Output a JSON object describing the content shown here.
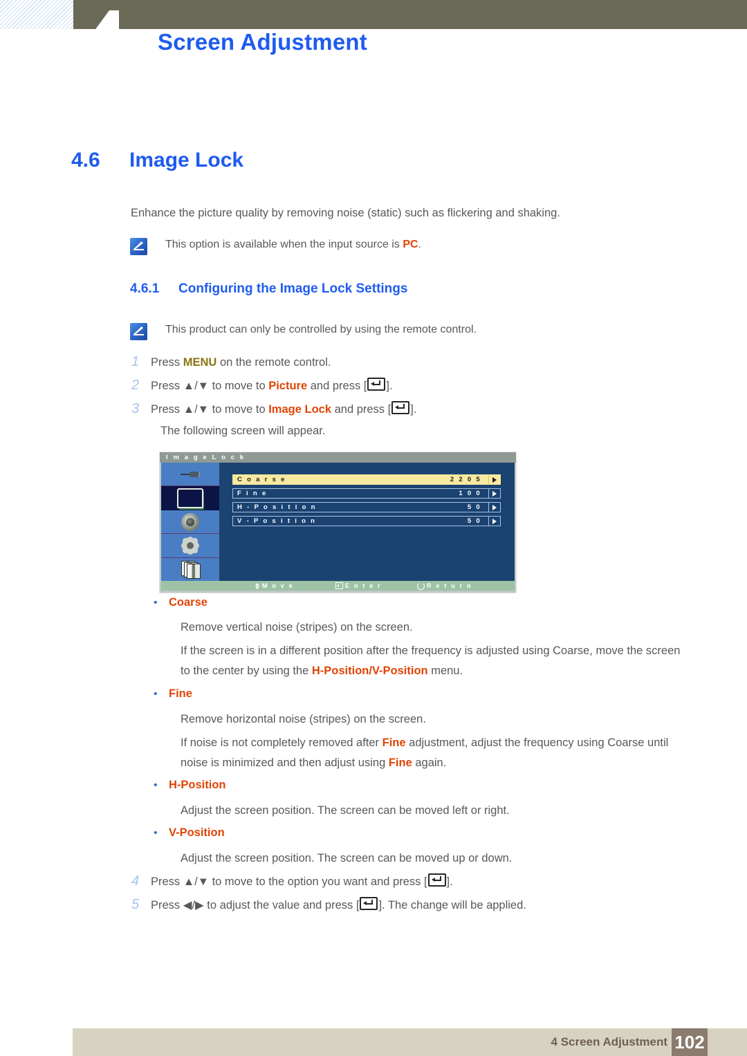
{
  "header": {
    "chapter_number": "4",
    "title": "Screen Adjustment"
  },
  "section": {
    "number": "4.6",
    "title": "Image Lock"
  },
  "intro": "Enhance the picture quality by removing noise (static) such as flickering and shaking.",
  "notes": [
    {
      "icon": "note-pencil-icon",
      "text_before": "This option is available when the input source is ",
      "keyword": "PC",
      "text_after": "."
    },
    {
      "icon": "note-pencil-icon",
      "text": "This product can only be controlled by using the remote control."
    }
  ],
  "subsection": {
    "number": "4.6.1",
    "title": "Configuring the Image Lock Settings"
  },
  "steps": [
    {
      "number": "1",
      "pre": "Press ",
      "keyword": "MENU",
      "keyword_color": "olive",
      "post": " on the remote control."
    },
    {
      "number": "2",
      "pre": "Press ▲/▼ to move to ",
      "keyword": "Picture",
      "keyword_color": "orange",
      "post": " and press [",
      "tail": "]."
    },
    {
      "number": "3",
      "pre": "Press ▲/▼ to move to ",
      "keyword": "Image Lock",
      "keyword_color": "orange",
      "post": " and press [",
      "tail": "]."
    },
    {
      "number": "4",
      "pre": "Press ▲/▼ to move to the option you want and press [",
      "tail": "]."
    },
    {
      "number": "5",
      "pre": "Press ◀/▶ to adjust the value and press [",
      "tail": "]. The change will be applied."
    }
  ],
  "step3_follow_up": "The following screen will appear.",
  "osd": {
    "title": "I m a g e   L o c k",
    "sidebar_icons": [
      "input-plug-icon",
      "monitor-picture-icon",
      "speaker-sound-icon",
      "gear-setup-icon",
      "multiscreen-stack-icon"
    ],
    "active_sidebar_index": 1,
    "rows": [
      {
        "label": "C o a r s e",
        "value": "2 2 0 5",
        "highlighted": true
      },
      {
        "label": "F i n e",
        "value": "1 0 0",
        "highlighted": false
      },
      {
        "label": "H - P o s i t i o n",
        "value": "5 0",
        "highlighted": false
      },
      {
        "label": "V - P o s i t i o n",
        "value": "5 0",
        "highlighted": false
      }
    ],
    "footer": {
      "move": "M o v e",
      "enter": "E n t e r",
      "return": "R e t u r n"
    },
    "colors": {
      "panel_bg": "#1b4372",
      "sidebar_bg": "#4a7ec4",
      "highlight": "#f7e9a0",
      "title_bar": "#8e9a93",
      "footer_bar": "#9ec2a6"
    }
  },
  "bullets": [
    {
      "title": "Coarse",
      "paragraphs": [
        "Remove vertical noise (stripes) on the screen.",
        {
          "pre": "If the screen is in a different position after the frequency is adjusted using Coarse, move the screen to the center by using the ",
          "keyword": "H-Position/V-Position",
          "post": " menu."
        }
      ]
    },
    {
      "title": "Fine",
      "paragraphs": [
        "Remove horizontal noise (stripes) on the screen.",
        {
          "pre": "If noise is not completely removed after ",
          "keyword": "Fine",
          "mid": " adjustment, adjust the frequency using Coarse until noise is minimized and then adjust using ",
          "keyword2": "Fine",
          "post": " again."
        }
      ]
    },
    {
      "title": "H-Position",
      "paragraphs": [
        "Adjust the screen position. The screen can be moved left or right."
      ]
    },
    {
      "title": "V-Position",
      "paragraphs": [
        "Adjust the screen position. The screen can be moved up or down."
      ]
    }
  ],
  "footer": {
    "label": "4 Screen Adjustment",
    "page_number": "102"
  },
  "colors": {
    "heading_blue": "#1f5bf0",
    "keyword_orange": "#e04405",
    "keyword_olive": "#8a7410",
    "body_gray": "#58585a",
    "olive_bar": "#6b6a56",
    "footer_beige": "#d8d3c0",
    "footer_page_bg": "#8a7b6d"
  }
}
